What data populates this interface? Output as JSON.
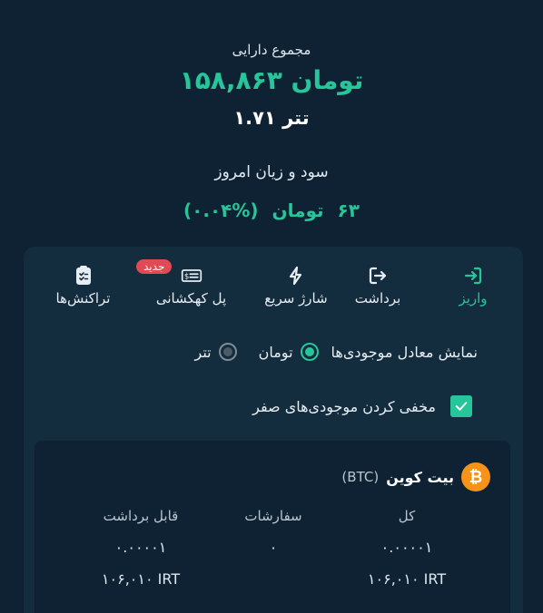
{
  "summary": {
    "total_label": "مجموع دارایی",
    "total_value": "۱۵۸,۸۶۳ تومان",
    "tether_value": "۱.۷۱ تتر",
    "pl_label": "سود و زیان امروز",
    "pl_amount": "۶۳",
    "pl_unit": "تومان",
    "pl_percent": "(%۰.۰۴)"
  },
  "actions": [
    {
      "label": "واریز",
      "icon": "deposit-icon",
      "active": true
    },
    {
      "label": "برداشت",
      "icon": "withdraw-icon"
    },
    {
      "label": "شارژ سریع",
      "icon": "lightning-icon"
    },
    {
      "label": "پل کهکشانی",
      "icon": "bridge-icon",
      "badge": "جدید"
    },
    {
      "label": "تراکنش‌ها",
      "icon": "clipboard-icon"
    }
  ],
  "display_options": {
    "label": "نمایش معادل موجودی‌ها",
    "options": [
      "تومان",
      "تتر"
    ],
    "selected": "تومان"
  },
  "hide_zero": {
    "label": "مخفی کردن موجودی‌های صفر",
    "checked": true
  },
  "asset": {
    "name": "بیت کوین",
    "symbol": "(BTC)",
    "icon": "bitcoin-icon",
    "columns": [
      {
        "header": "کل",
        "value": "۰.۰۰۰۰۱",
        "irt": "۱۰۶,۰۱۰ IRT"
      },
      {
        "header": "سفارشات",
        "value": "۰",
        "irt": ""
      },
      {
        "header": "قابل برداشت",
        "value": "۰.۰۰۰۰۱",
        "irt": "۱۰۶,۰۱۰ IRT"
      }
    ]
  },
  "colors": {
    "accent": "#27c59a",
    "background": "#0f2233",
    "card": "#132c3e",
    "badge": "#e04a55",
    "bitcoin": "#f7931a"
  }
}
